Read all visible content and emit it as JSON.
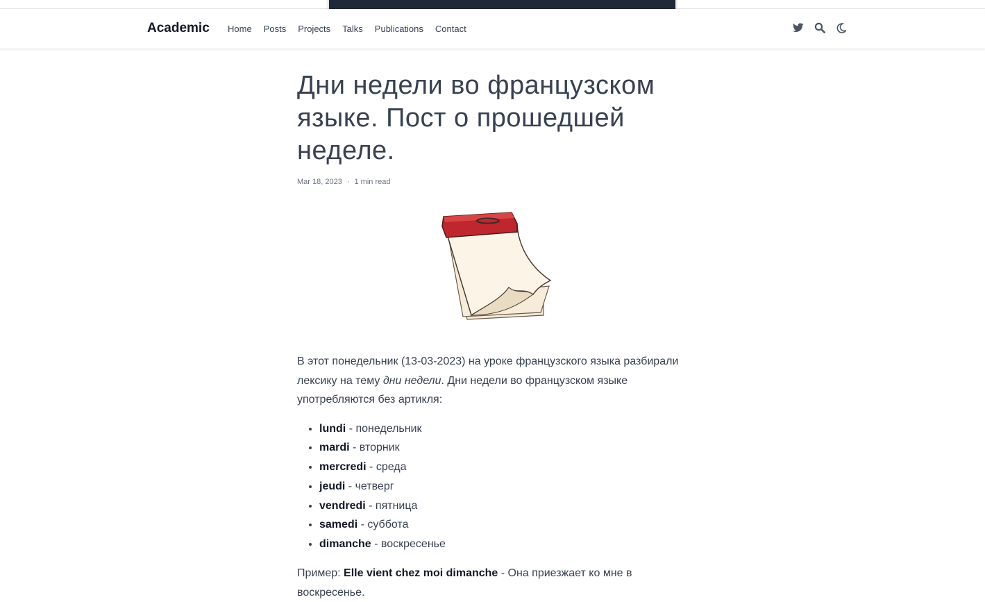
{
  "brand": "Academic",
  "nav": {
    "links": [
      "Home",
      "Posts",
      "Projects",
      "Talks",
      "Publications",
      "Contact"
    ],
    "icons": [
      "twitter-icon",
      "search-icon",
      "moon-icon"
    ]
  },
  "article": {
    "title": "Дни недели во французском языке. Пост о прошедшей неделе.",
    "date": "Mar 18, 2023",
    "separator": "·",
    "read_time": "1 min read",
    "intro_part1": "В этот понедельник (13-03-2023) на уроке французского языка разбирали лексику на тему ",
    "intro_em": "дни недели",
    "intro_part2": ". Дни недели во французском языке употребляются без артикля:",
    "days": [
      {
        "fr": "lundi",
        "ru": " - понедельник"
      },
      {
        "fr": "mardi",
        "ru": " - вторник"
      },
      {
        "fr": "mercredi",
        "ru": " - среда"
      },
      {
        "fr": "jeudi",
        "ru": " - четверг"
      },
      {
        "fr": "vendredi",
        "ru": " - пятница"
      },
      {
        "fr": "samedi",
        "ru": " - суббота"
      },
      {
        "fr": "dimanche",
        "ru": " - воскресенье"
      }
    ],
    "example_label": "Пример: ",
    "example_fr": "Elle vient chez moi dimanche",
    "example_ru": " - Она приезжает ко мне в воскресенье."
  },
  "colors": {
    "text": "#374151",
    "toast_bg": "#1f2937",
    "calendar_red": "#c0262d"
  }
}
